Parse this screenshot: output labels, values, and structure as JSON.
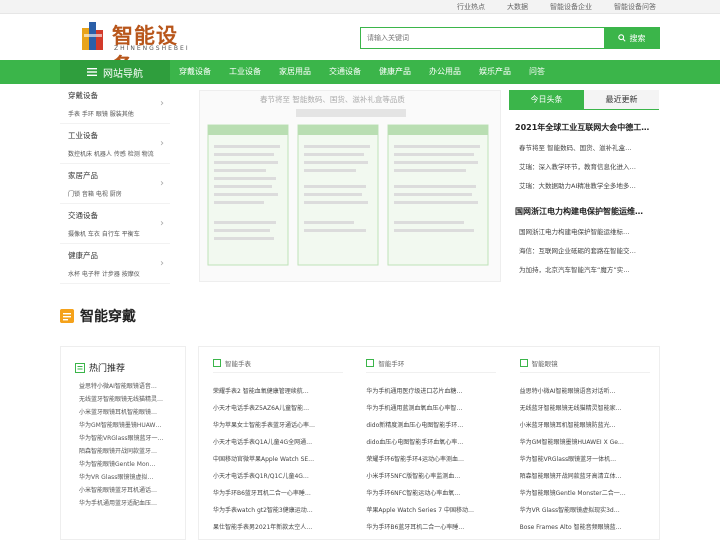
{
  "toplinks": [
    "行业热点",
    "大数据",
    "智能设备企业",
    "智能设备问答"
  ],
  "logo": {
    "cn": "智能设备",
    "en": "ZHINENGSHEBEI"
  },
  "search": {
    "placeholder": "请输入关键词",
    "button": "搜索"
  },
  "nav": {
    "home": "网站导航",
    "items": [
      "穿戴设备",
      "工业设备",
      "家居用品",
      "交通设备",
      "健康产品",
      "办公用品",
      "娱乐产品",
      "问答"
    ]
  },
  "categories": [
    {
      "title": "穿戴设备",
      "sub": "手表 手环 眼镜 服装其他"
    },
    {
      "title": "工业设备",
      "sub": "数控机床 机器人 传感 检测 物流"
    },
    {
      "title": "家居产品",
      "sub": "门锁 音箱 电视 厨房"
    },
    {
      "title": "交通设备",
      "sub": "摄像机 车衣 自行车 平衡车"
    },
    {
      "title": "健康产品",
      "sub": "水杯 电子秤 计步器 按摩仪"
    }
  ],
  "banner": {
    "alt": "春节将至 智能数码、国货、滋补礼盒等品质"
  },
  "news": {
    "tabs": [
      "今日头条",
      "最近更新"
    ],
    "head1": "2021年全球工业互联网大会中德工…",
    "lines1": [
      "春节将至 智能数码、国货、滋补礼盒…",
      "艾瑞：深入教学环节，教育信息化进入…",
      "艾瑞：大数据助力AI精准教学全多地多…"
    ],
    "head2": "国网浙江电力构建电保护智能运维…",
    "lines2": [
      "国网浙江电力构建电保护智能运维标…",
      "海信：互联网企业砥砺的套路在智能交…",
      "为加持，北京汽车智能汽车“魔方”实…"
    ]
  },
  "section": {
    "title": "智能穿戴"
  },
  "hot": {
    "title": "热门推荐",
    "items": [
      "益思特小微AI智能眼镜语音…",
      "无线蓝牙智能眼镜无线猫精灵…",
      "小米蓝牙眼镜耳机智能眼镜…",
      "华为GM智能眼镜墨镜HUAW…",
      "华为智能VRGlass眼镜蓝牙一…",
      "陌森智能眼镜开战同款蓝牙…",
      "华为智能眼镜Gentle Mon…",
      "华为VR Glass眼镜镜虚拟…",
      "小米智能眼镜蓝牙耳机通话…",
      "华为手机通用蓝牙适配血压…"
    ]
  },
  "columns": [
    {
      "title": "智能手表",
      "items": [
        "荣耀手表2 智能血氧健康管理续航…",
        "小天才电话手表Z5AZ6A儿童智能…",
        "华为苹果女士智能手表蓝牙通话心率…",
        "小天才电话手表Q1A儿童4G全网通…",
        "中国移动官微苹果Apple Watch SE…",
        "小天才电话手表Q1R/Q1C儿童4G…",
        "华为手环B6蓝牙耳机二合一心率睡…",
        "华为手表watch gt2智能3健康运动…",
        "果仕智能手表男2021年新款太空人…"
      ]
    },
    {
      "title": "智能手环",
      "items": [
        "华为手机通用医疗级进口芯片血糖…",
        "华为手机通用蓝测血氧血压心率智…",
        "dido新精度测血压心电图智能手环…",
        "dido血压心电图智能手环血氧心率…",
        "荣耀手环6智能手环4运动心率测血…",
        "小米手环5NFC版智能心率监测血…",
        "华为手环6NFC智能运动心率血氧…",
        "苹果Apple Watch Series 7 中国移动…",
        "华为手环B6蓝牙耳机二合一心率睡…"
      ]
    },
    {
      "title": "智能眼镜",
      "items": [
        "益思特小微AI智能眼镜语音对话听…",
        "无线蓝牙智能眼镜无线猫精灵智能家…",
        "小米蓝牙眼镜耳机智能眼镜防蓝光…",
        "华为GM智能眼镜墨镜HUAWEI X Ge…",
        "华为智能VRGlass眼镜蓝牙一体机…",
        "陌森智能眼镜开战同款蓝牙高清立体…",
        "华为智能眼镜Gentle Monster二合一…",
        "华为VR Glass智能眼镜虚拟现实3d…",
        "Bose Frames Alto 智能音频眼镜蓝…"
      ]
    }
  ],
  "colors": {
    "accent": "#3bb54a",
    "accent_dark": "#2f9e3d",
    "logo": "#b8561b",
    "section_icon": "#f5a21b"
  }
}
